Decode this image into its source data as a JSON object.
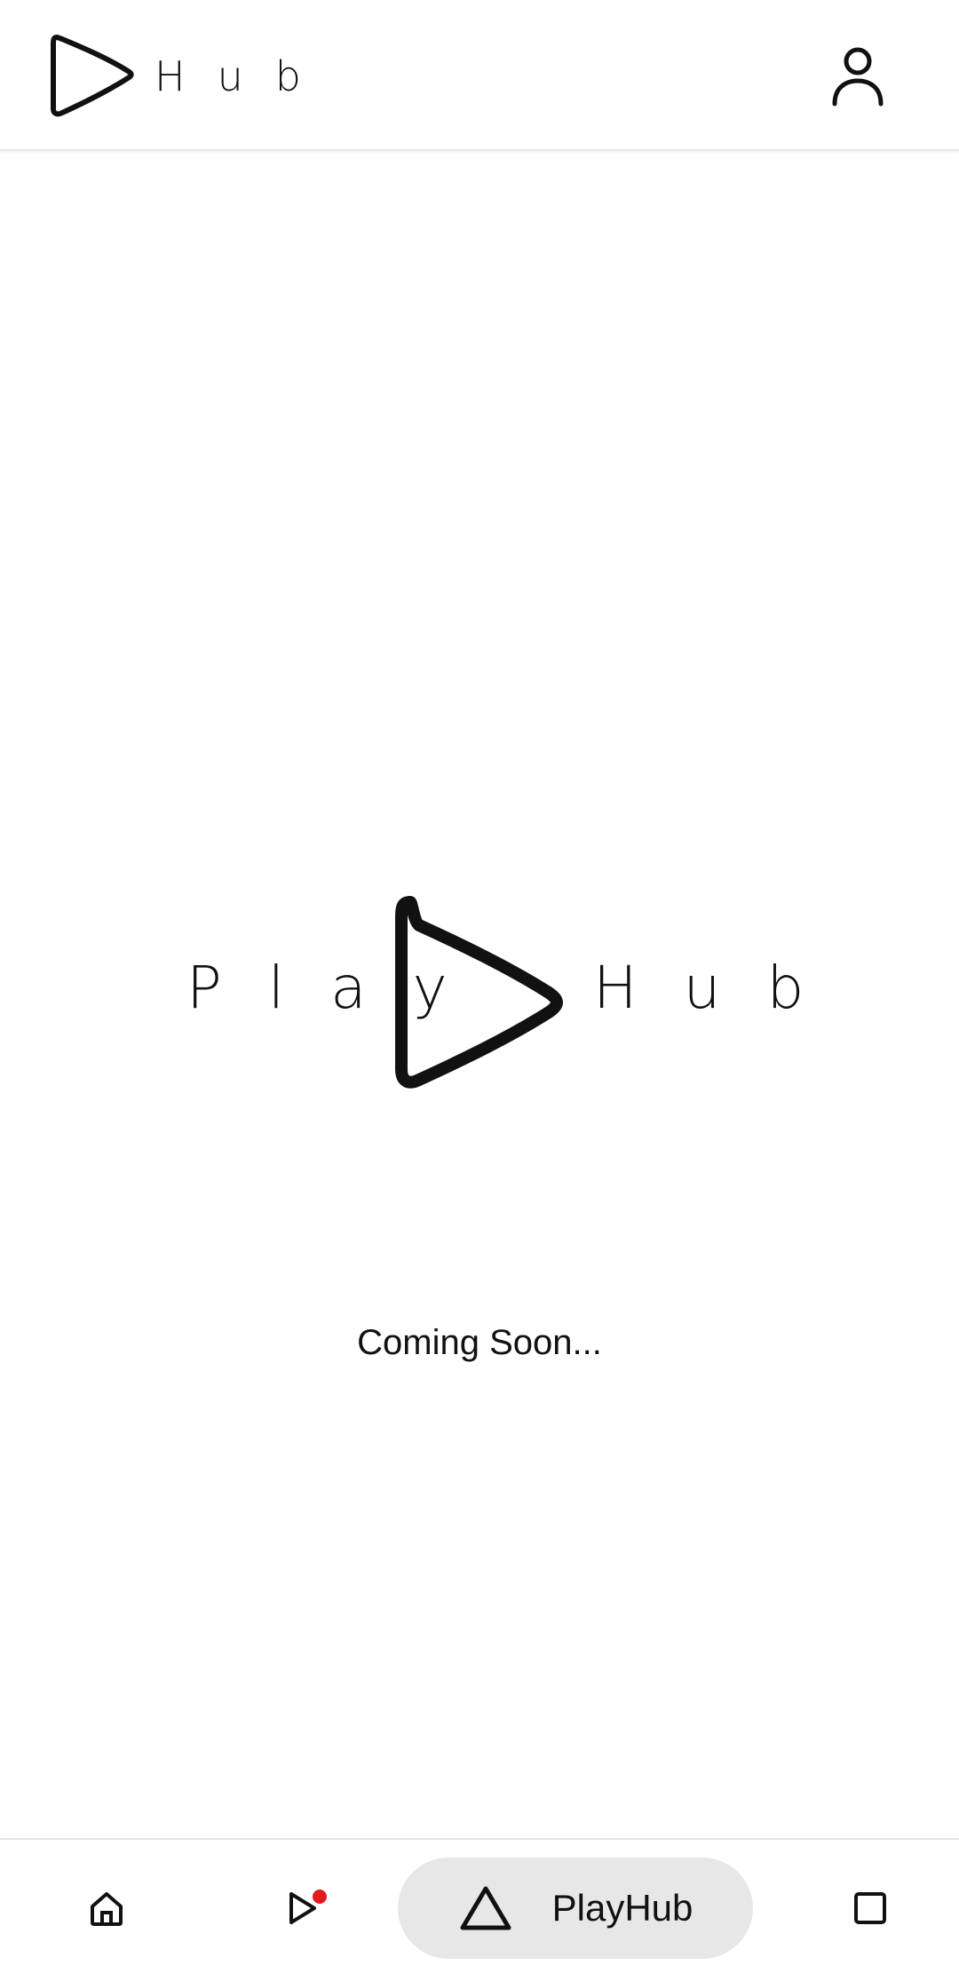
{
  "header": {
    "brand_text": [
      "H",
      "u",
      "b"
    ],
    "profile_icon": "person-icon"
  },
  "main": {
    "brand_left": [
      "P",
      "l",
      "a",
      "y"
    ],
    "brand_right": [
      "H",
      "u",
      "b"
    ],
    "status_text": "Coming Soon..."
  },
  "bottom_nav": {
    "items": [
      {
        "icon": "home-icon"
      },
      {
        "icon": "play-icon",
        "badge_color": "#e21b1b"
      },
      {
        "icon": "triangle-icon",
        "label": "PlayHub",
        "selected": true
      },
      {
        "icon": "square-icon"
      }
    ]
  },
  "colors": {
    "pill_background": "#e7e7e7",
    "badge": "#e21b1b"
  }
}
